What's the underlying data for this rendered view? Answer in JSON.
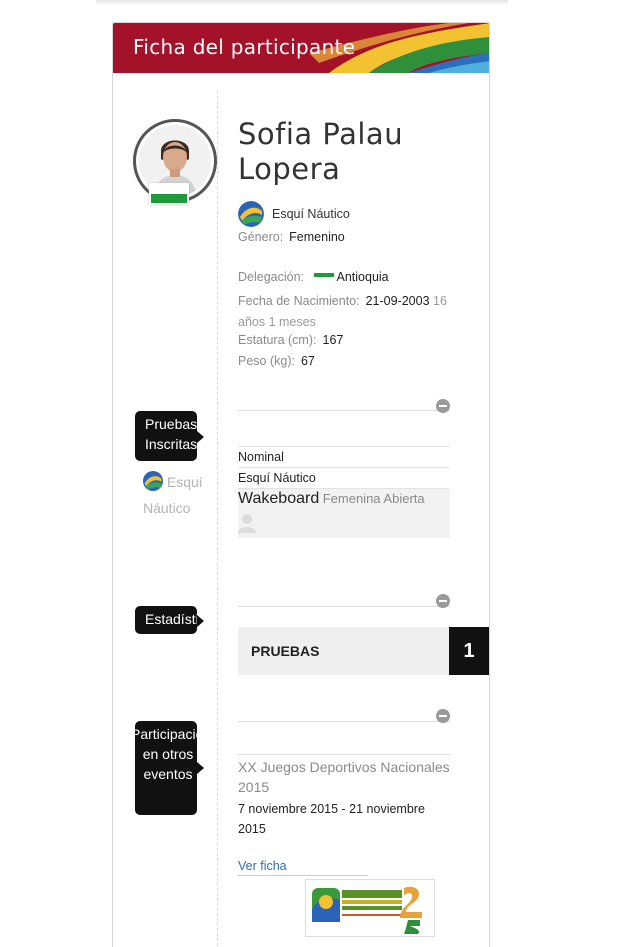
{
  "header": {
    "title": "Ficha del participante"
  },
  "participant": {
    "name": "Sofia Palau Lopera",
    "sport": "Esquí Náutico",
    "gender_label": "Género:",
    "gender": "Femenino",
    "delegation_label": "Delegación:",
    "delegation": "Antioquia",
    "birth_label": "Fecha de Nacimiento:",
    "birth_date": "21-09-2003",
    "age": "16 años 1 meses",
    "height_label": "Estatura (cm):",
    "height": "167",
    "weight_label": "Peso (kg):",
    "weight": "67"
  },
  "tags": {
    "pruebas_inscritas": "Pruebas Inscritas",
    "estadisticas": "Estadísticas",
    "participaciones": "Participaciones en otros eventos"
  },
  "pruebas": {
    "side_sport": "Esquí Náutico",
    "table_header": "Nominal",
    "table_sport": "Esquí Náutico",
    "event_name": "Wakeboard",
    "event_category": "Femenina Abierta"
  },
  "stats": {
    "label": "PRUEBAS",
    "count": "1"
  },
  "events": {
    "title": "XX Juegos Deportivos Nacionales 2015",
    "dates": "7 noviembre 2015 - 21 noviembre 2015",
    "link": "Ver ficha"
  },
  "colors": {
    "header": "#a4122a",
    "tag_bg": "#111111",
    "link": "#2f6fb0",
    "flag_green": "#1f9a3a"
  }
}
